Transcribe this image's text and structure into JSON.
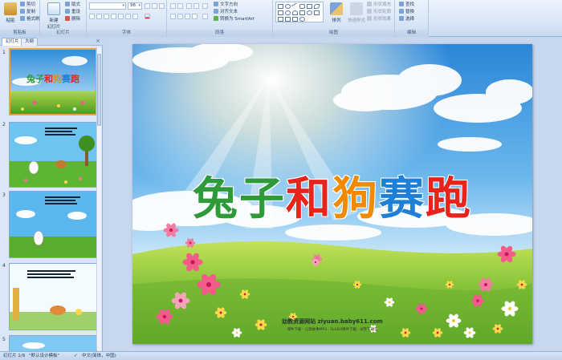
{
  "ribbon": {
    "clipboard": {
      "paste": "粘贴",
      "cut": "剪切",
      "copy": "复制",
      "format_painter": "格式刷",
      "label": "剪贴板"
    },
    "slides": {
      "new_slide": "新建\n幻灯片",
      "layout": "版式",
      "reset": "重设",
      "delete": "删除",
      "label": "幻灯片"
    },
    "font": {
      "font_name": "",
      "font_size": "96",
      "label": "字体"
    },
    "paragraph": {
      "text_direction": "文字方向",
      "align_text": "对齐文本",
      "smartart": "转换为 SmartArt",
      "label": "段落"
    },
    "drawing": {
      "arrange": "排列",
      "quick_styles": "快速样式",
      "shape_fill": "形状填充",
      "shape_outline": "形状轮廓",
      "shape_effects": "形状效果",
      "label": "绘图"
    },
    "editing": {
      "find": "查找",
      "replace": "替换",
      "select": "选择",
      "label": "编辑"
    }
  },
  "left_pane": {
    "tabs": [
      "幻灯片",
      "大纲"
    ],
    "close": "×",
    "slides": [
      {
        "number": "1",
        "selected": true,
        "title": "兔子和狗赛跑"
      },
      {
        "number": "2",
        "selected": false
      },
      {
        "number": "3",
        "selected": false
      },
      {
        "number": "4",
        "selected": false
      },
      {
        "number": "5",
        "selected": false
      }
    ]
  },
  "slide": {
    "title_chars": [
      {
        "char": "兔",
        "color": "#2e9a3a"
      },
      {
        "char": "子",
        "color": "#2e9a3a"
      },
      {
        "char": "和",
        "color": "#e8231c"
      },
      {
        "char": "狗",
        "color": "#f08a00"
      },
      {
        "char": "赛",
        "color": "#1e7fd6"
      },
      {
        "char": "跑",
        "color": "#e8231c"
      }
    ],
    "watermark": "幼教资源网站 ziyuan.baby611.com",
    "watermark_sub": "课件下载 · 儿歌故事MP3 · FLASH课件下载 · 试卷下载等"
  },
  "status_bar": {
    "slide_pos": "幻灯片 1/9",
    "theme": "\"默认设计模板\"",
    "language": "中文(简体，中国)"
  },
  "colors": {
    "ribbon_bg": "#dce8f7",
    "selection": "#f0a33a",
    "sky": "#3d9be0",
    "grass": "#7cc23a"
  }
}
